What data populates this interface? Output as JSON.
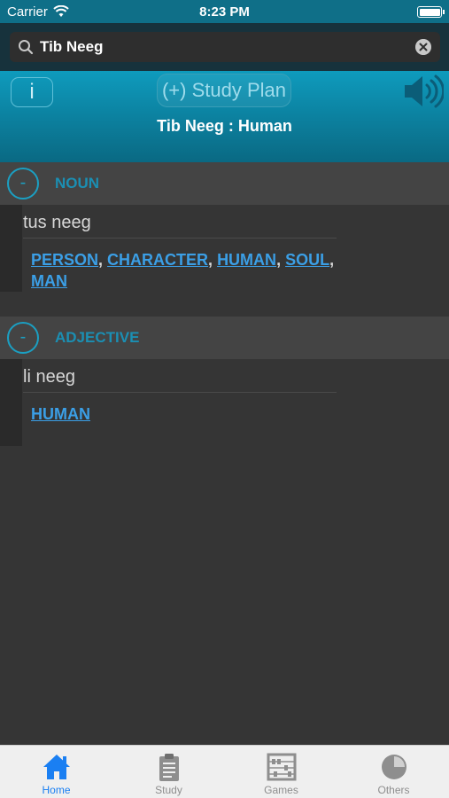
{
  "status_bar": {
    "carrier": "Carrier",
    "time": "8:23 PM"
  },
  "search": {
    "value": "Tib Neeg"
  },
  "header": {
    "info_label": "i",
    "study_plan_label": "(+) Study Plan",
    "title": "Tib Neeg : Human"
  },
  "sections": [
    {
      "collapse_label": "-",
      "pos": "NOUN",
      "translation": "tus neeg",
      "synonyms": [
        "PERSON",
        "CHARACTER",
        "HUMAN",
        "SOUL",
        "MAN"
      ]
    },
    {
      "collapse_label": "-",
      "pos": "ADJECTIVE",
      "translation": "li neeg",
      "synonyms": [
        "HUMAN"
      ]
    }
  ],
  "tabs": [
    {
      "label": "Home",
      "icon": "home-icon",
      "active": true
    },
    {
      "label": "Study",
      "icon": "clipboard-icon",
      "active": false
    },
    {
      "label": "Games",
      "icon": "abacus-icon",
      "active": false
    },
    {
      "label": "Others",
      "icon": "pie-chart-icon",
      "active": false
    }
  ],
  "colors": {
    "accent": "#1b9fc2",
    "link": "#3b9fe6",
    "tab_active": "#1a7ff2"
  }
}
